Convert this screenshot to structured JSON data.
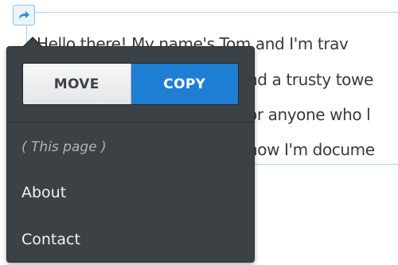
{
  "paragraph": {
    "line1": "Hello there! My name's Tom and I'm trav",
    "line2": "nd a trusty towe",
    "line3": "or anyone who l",
    "line4": "how I'm docume"
  },
  "popover": {
    "move_label": "MOVE",
    "copy_label": "COPY",
    "active_mode": "COPY",
    "destinations": [
      {
        "label": "( This page )",
        "current": true
      },
      {
        "label": "About",
        "current": false
      },
      {
        "label": "Contact",
        "current": false
      }
    ]
  },
  "colors": {
    "accent": "#1e7ed4",
    "popover_bg": "#3c4145",
    "selection_outline": "#a9d3f5"
  },
  "icons": {
    "handle": "arrow-share-icon"
  }
}
